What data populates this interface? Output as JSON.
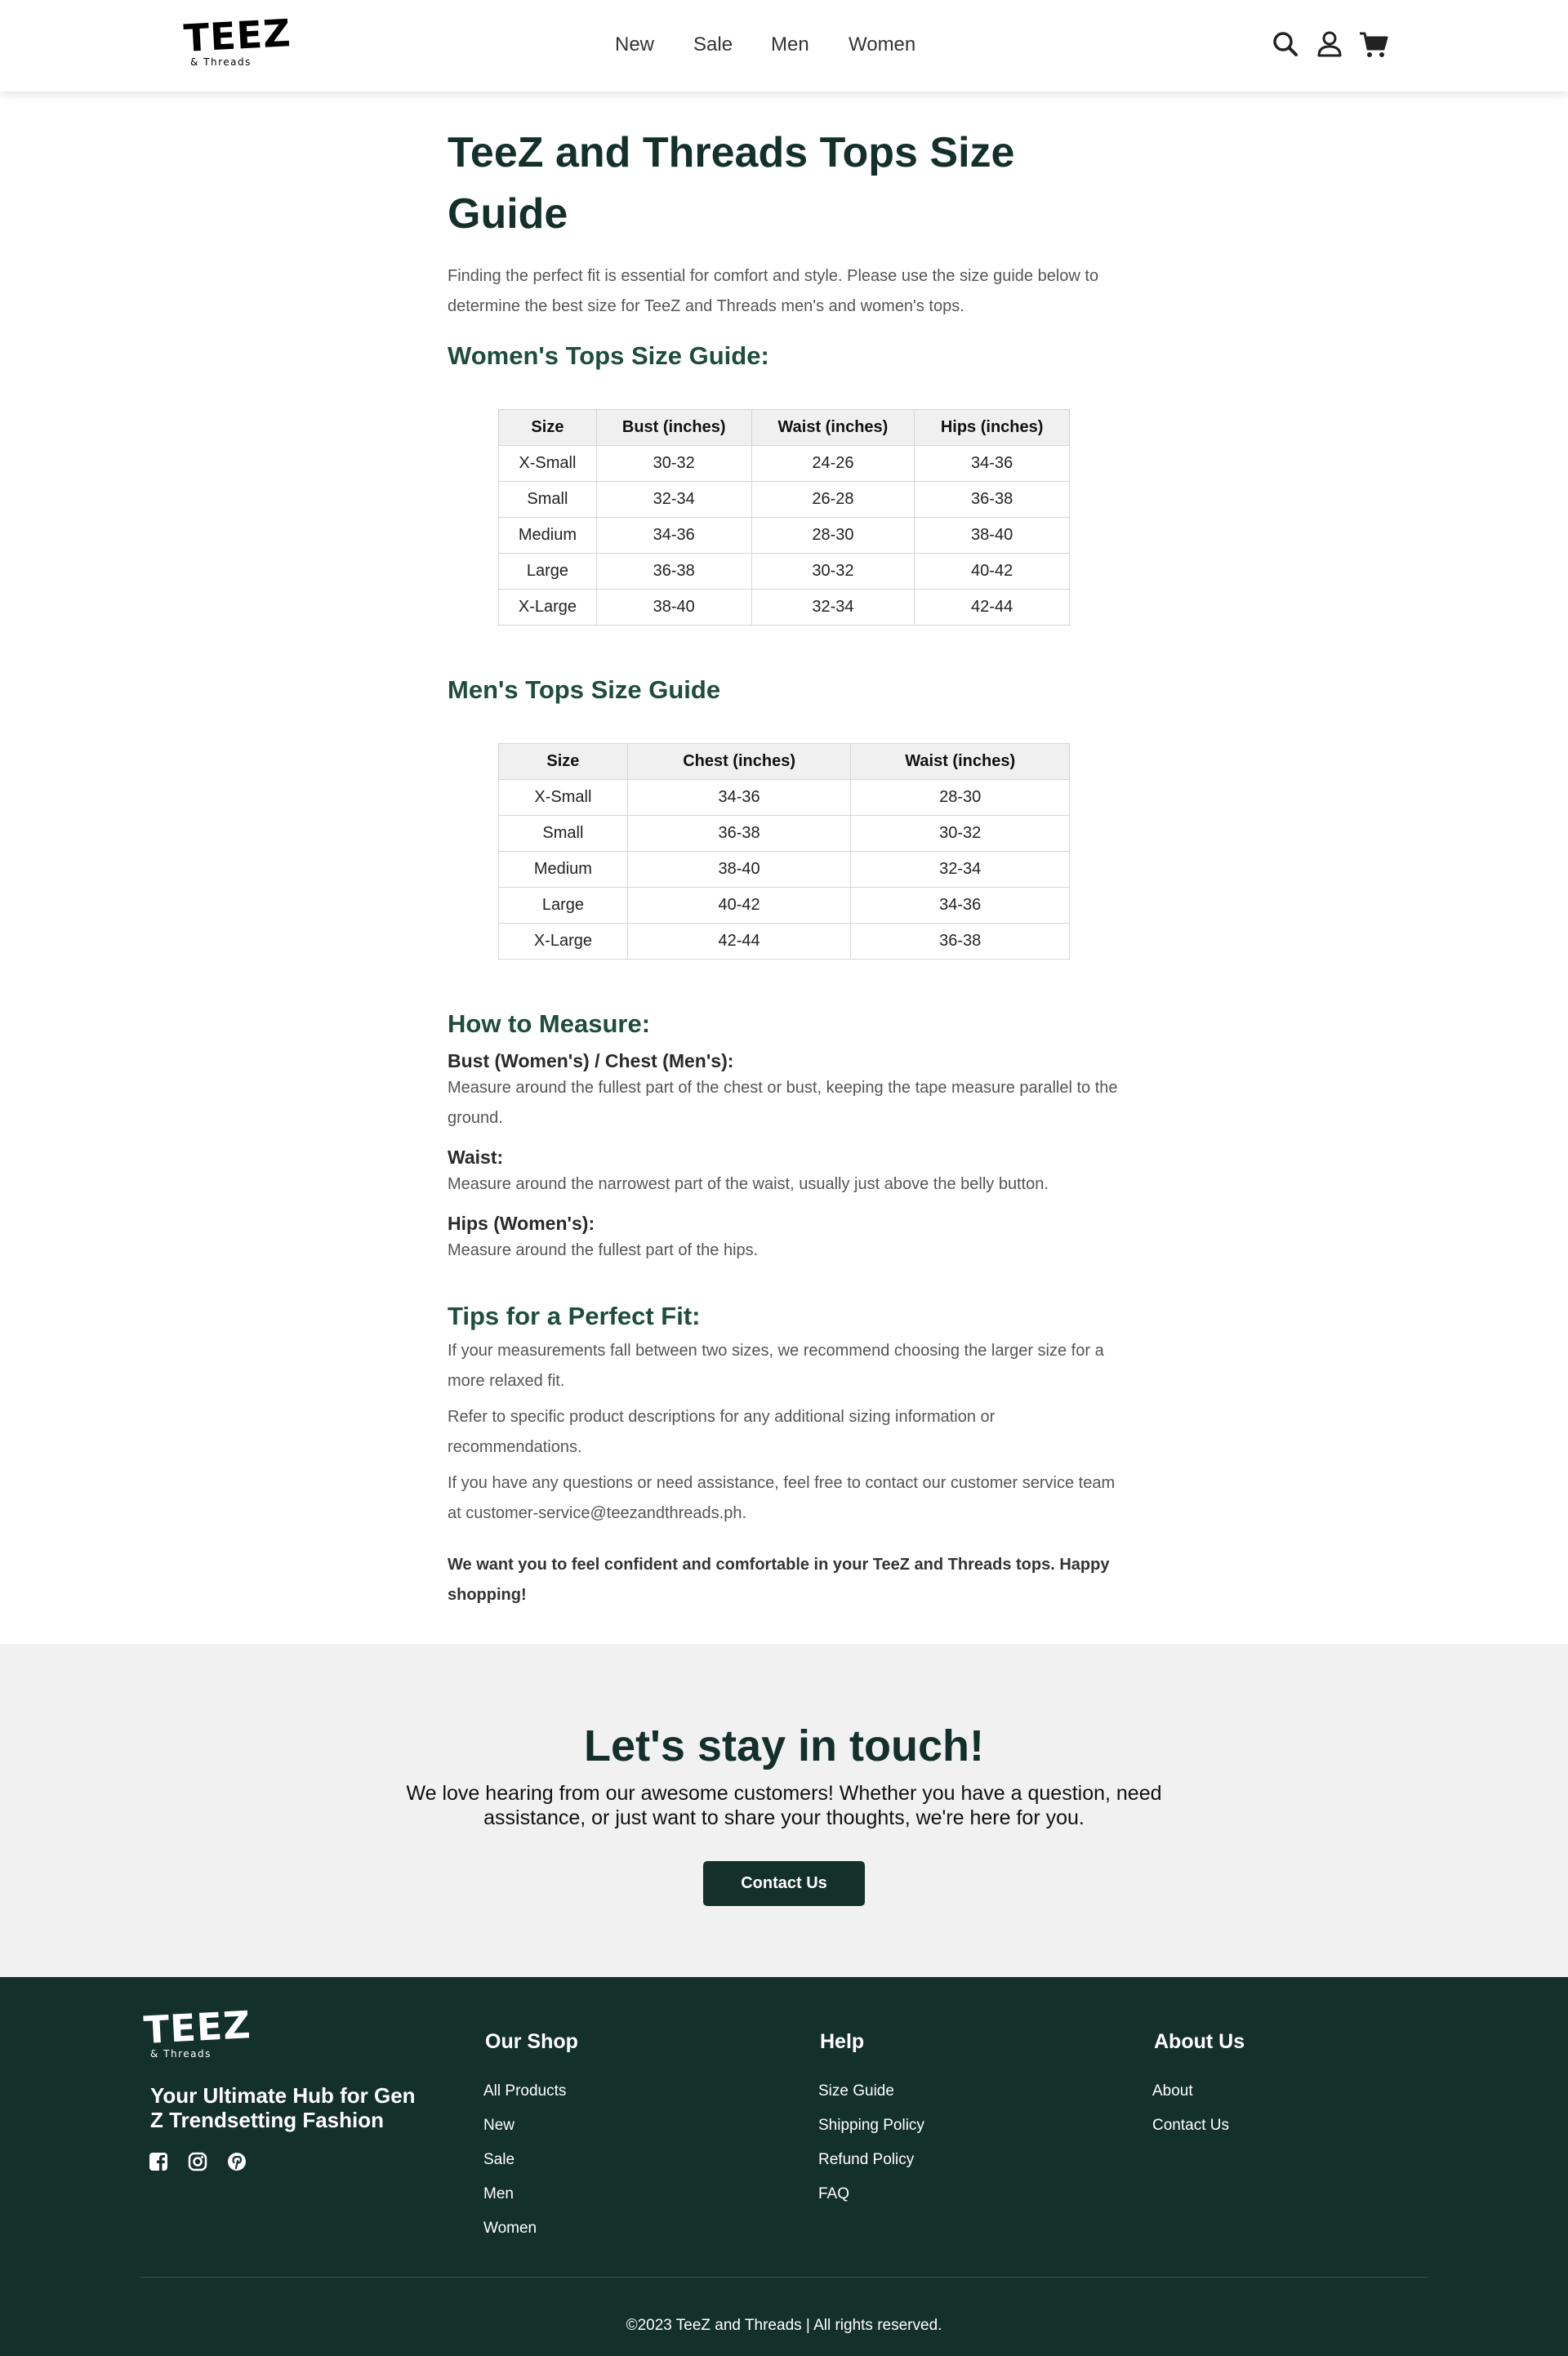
{
  "header": {
    "logo": {
      "main": "TEEZ",
      "sub": "& Threads"
    },
    "nav": [
      {
        "label": "New"
      },
      {
        "label": "Sale"
      },
      {
        "label": "Men"
      },
      {
        "label": "Women"
      }
    ],
    "icons": [
      "search-icon",
      "user-icon",
      "cart-icon"
    ]
  },
  "article": {
    "title": "TeeZ and Threads Tops Size Guide",
    "intro": "Finding the perfect fit is essential for comfort and style. Please use the size guide below to determine the best size for TeeZ and Threads men's and women's tops.",
    "womens": {
      "heading": "Women's Tops Size Guide:",
      "columns": [
        "Size",
        "Bust (inches)",
        "Waist (inches)",
        "Hips (inches)"
      ],
      "rows": [
        [
          "X-Small",
          "30-32",
          "24-26",
          "34-36"
        ],
        [
          "Small",
          "32-34",
          "26-28",
          "36-38"
        ],
        [
          "Medium",
          "34-36",
          "28-30",
          "38-40"
        ],
        [
          "Large",
          "36-38",
          "30-32",
          "40-42"
        ],
        [
          "X-Large",
          "38-40",
          "32-34",
          "42-44"
        ]
      ]
    },
    "mens": {
      "heading": "Men's Tops Size Guide",
      "columns": [
        "Size",
        "Chest (inches)",
        "Waist (inches)"
      ],
      "rows": [
        [
          "X-Small",
          "34-36",
          "28-30"
        ],
        [
          "Small",
          "36-38",
          "30-32"
        ],
        [
          "Medium",
          "38-40",
          "32-34"
        ],
        [
          "Large",
          "40-42",
          "34-36"
        ],
        [
          "X-Large",
          "42-44",
          "36-38"
        ]
      ]
    },
    "measure": {
      "heading": "How to Measure:",
      "items": [
        {
          "title": "Bust (Women's) / Chest (Men's):",
          "text": "Measure around the fullest part of the chest or bust, keeping the tape measure parallel to the ground."
        },
        {
          "title": "Waist:",
          "text": "Measure around the narrowest part of the waist, usually just above the belly button."
        },
        {
          "title": "Hips (Women's):",
          "text": "Measure around the fullest part of the hips."
        }
      ]
    },
    "tips": {
      "heading": "Tips for a Perfect Fit:",
      "items": [
        "If your measurements fall between two sizes, we recommend choosing the larger size for a more relaxed fit.",
        "Refer to specific product descriptions for any additional sizing information or recommendations.",
        "If you have any questions or need assistance, feel free to contact our customer service team at customer-service@teezandthreads.ph."
      ],
      "closing": "We want you to feel confident and comfortable in your TeeZ and Threads tops. Happy shopping!"
    }
  },
  "contact": {
    "heading": "Let's stay in touch!",
    "text": "We love hearing from our awesome customers! Whether you have a question, need assistance, or just want to share your thoughts, we're here for you.",
    "button": "Contact Us"
  },
  "footer": {
    "logo": {
      "main": "TEEZ",
      "sub": "& Threads"
    },
    "tagline": "Your Ultimate Hub for Gen Z Trendsetting Fashion",
    "social": [
      "facebook-icon",
      "instagram-icon",
      "pinterest-icon"
    ],
    "columns": [
      {
        "title": "Our Shop",
        "links": [
          "All Products",
          "New",
          "Sale",
          "Men",
          "Women"
        ]
      },
      {
        "title": "Help",
        "links": [
          "Size Guide",
          "Shipping Policy",
          "Refund Policy",
          "FAQ"
        ]
      },
      {
        "title": "About Us",
        "links": [
          "About",
          "Contact Us"
        ]
      }
    ],
    "copyright": "©2023 TeeZ and Threads | All rights reserved."
  },
  "colors": {
    "primary_dark": "#14302a",
    "heading_green": "#1e4d3b",
    "band_gray": "#f1f1f1",
    "table_header": "#f0f0f0"
  }
}
